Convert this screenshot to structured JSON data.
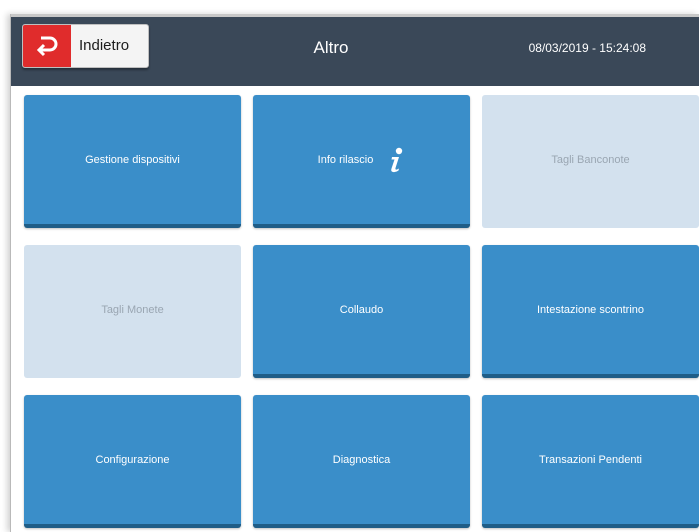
{
  "header": {
    "back_label": "Indietro",
    "title": "Altro",
    "datetime": "08/03/2019 - 15:24:08"
  },
  "tiles": [
    {
      "label": "Gestione dispositivi",
      "enabled": true
    },
    {
      "label": "Info rilascio",
      "enabled": true,
      "icon": "info-icon"
    },
    {
      "label": "Tagli Banconote",
      "enabled": false
    },
    {
      "label": "Tagli Monete",
      "enabled": false
    },
    {
      "label": "Collaudo",
      "enabled": true
    },
    {
      "label": "Intestazione scontrino",
      "enabled": true
    },
    {
      "label": "Configurazione",
      "enabled": true
    },
    {
      "label": "Diagnostica",
      "enabled": true
    },
    {
      "label": "Transazioni Pendenti",
      "enabled": true
    }
  ],
  "colors": {
    "header_bg": "#3a4858",
    "tile_active": "#3a8ec9",
    "tile_disabled": "#d3e1ee",
    "back_icon_bg": "#e02c2c"
  }
}
